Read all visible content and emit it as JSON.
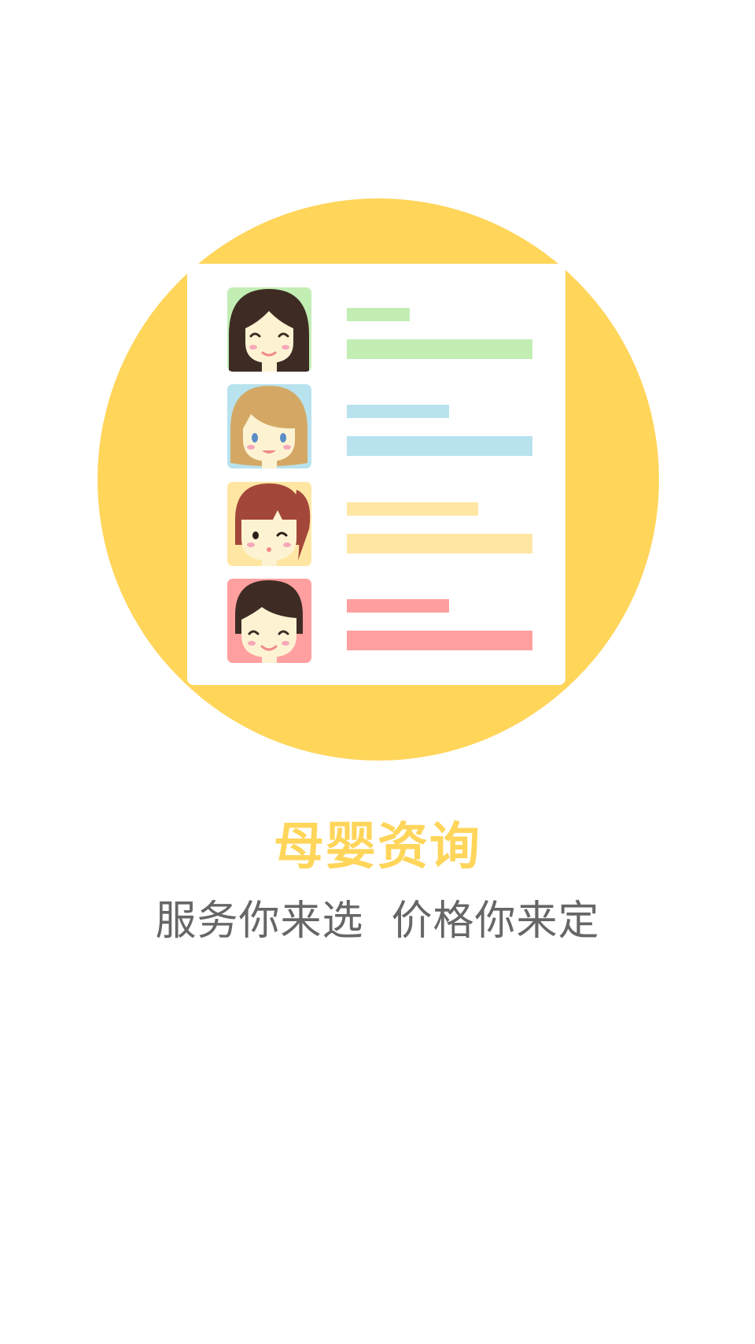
{
  "colors": {
    "accent_yellow": "#FFD55A",
    "card_background": "#FFFFFF",
    "title_color": "#FFD55A",
    "subtitle_color": "#666666",
    "green": "#C2EEB4",
    "blue": "#B8E2EE",
    "light_yellow": "#FFE7A3",
    "pink": "#FF9F9F"
  },
  "illustration": {
    "rows": [
      {
        "avatar_icon": "girl-black-hair-avatar-icon",
        "color": "#C2EEB4",
        "short_bar_fraction": 0.34,
        "long_bar_fraction": 1.0
      },
      {
        "avatar_icon": "girl-blonde-hair-avatar-icon",
        "color": "#B8E2EE",
        "short_bar_fraction": 0.55,
        "long_bar_fraction": 1.0
      },
      {
        "avatar_icon": "girl-red-ponytail-avatar-icon",
        "color": "#FFE7A3",
        "short_bar_fraction": 0.71,
        "long_bar_fraction": 1.0
      },
      {
        "avatar_icon": "boy-dark-hair-avatar-icon",
        "color": "#FF9F9F",
        "short_bar_fraction": 0.55,
        "long_bar_fraction": 1.0
      }
    ]
  },
  "text": {
    "title": "母婴资询",
    "subtitle": "服务你来选  价格你来定"
  }
}
